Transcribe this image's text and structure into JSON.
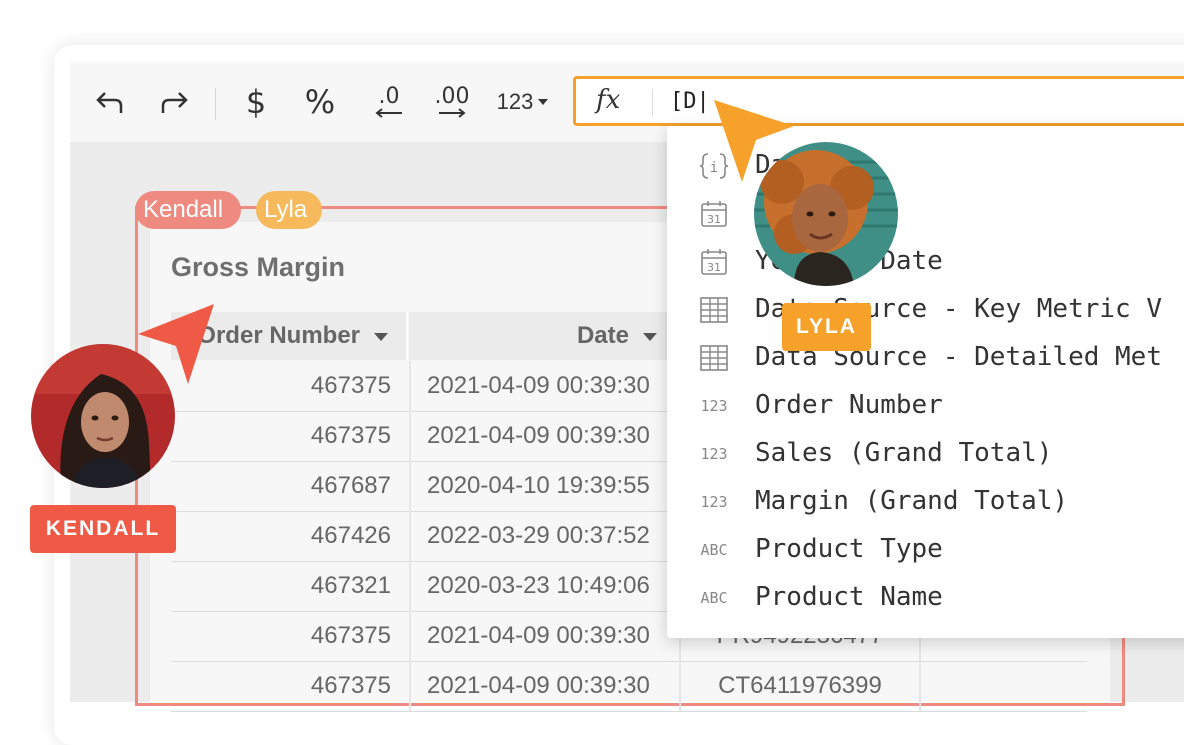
{
  "toolbar": {
    "undo": "undo-icon",
    "redo": "redo-icon",
    "currency_label": "$",
    "percent_label": "%",
    "decimal_decrease_label": ".0",
    "decimal_increase_label": ".00",
    "number_format_label": "123"
  },
  "formula_bar": {
    "fx_label": "fx",
    "value": "[D|"
  },
  "element": {
    "title": "Gross Margin",
    "tags": [
      "Kendall",
      "Lyla"
    ],
    "columns": [
      "Order Number",
      "Date"
    ],
    "rows": [
      [
        "467375",
        "2021-04-09 00:39:30",
        ""
      ],
      [
        "467375",
        "2021-04-09 00:39:30",
        ""
      ],
      [
        "467687",
        "2020-04-10 19:39:55",
        ""
      ],
      [
        "467426",
        "2022-03-29 00:37:52",
        ""
      ],
      [
        "467321",
        "2020-03-23 10:49:06",
        ""
      ],
      [
        "467375",
        "2021-04-09 00:39:30",
        "PR9492236477"
      ],
      [
        "467375",
        "2021-04-09 00:39:30",
        "CT6411976399"
      ]
    ]
  },
  "autocomplete": {
    "items": [
      {
        "icon": "info-bracket-icon",
        "label": "Da"
      },
      {
        "icon": "calendar-icon",
        "label": ""
      },
      {
        "icon": "calendar-icon",
        "label": "Ye      Date"
      },
      {
        "icon": "table-icon",
        "label": "Data Source - Key Metric V"
      },
      {
        "icon": "table-icon",
        "label": "Data Source - Detailed Met"
      },
      {
        "icon": "number-type-icon",
        "icon_text": "123",
        "label": "Order Number"
      },
      {
        "icon": "number-type-icon",
        "icon_text": "123",
        "label": "Sales (Grand Total)"
      },
      {
        "icon": "number-type-icon",
        "icon_text": "123",
        "label": "Margin (Grand Total)"
      },
      {
        "icon": "text-type-icon",
        "icon_text": "ABC",
        "label": "Product Type"
      },
      {
        "icon": "text-type-icon",
        "icon_text": "ABC",
        "label": "Product Name"
      }
    ]
  },
  "collaborators": {
    "kendall": {
      "badge": "KENDALL",
      "color": "#ee5a46"
    },
    "lyla": {
      "badge": "LYLA",
      "color": "#f5a12a"
    }
  },
  "colors": {
    "accent": "#f5a12a",
    "kendall": "#ee5a46",
    "kendall_tag": "#ef8a80",
    "lyla_tag": "#f6b95c"
  }
}
